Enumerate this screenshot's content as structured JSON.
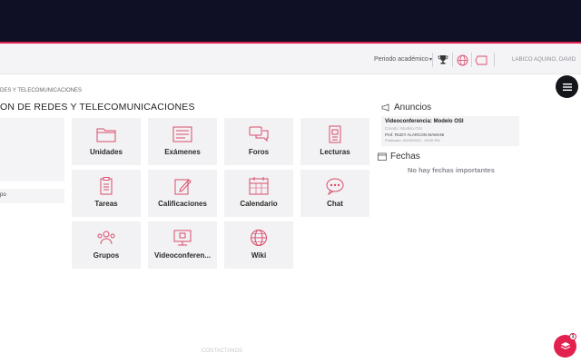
{
  "header": {
    "periodo_label": "Periodo académico",
    "username": "LABICO AQUINO, DAVID"
  },
  "breadcrumb": "DES Y TELECOMUNICACIONES",
  "course_title": "ON DE REDES Y TELECOMUNICACIONES",
  "left_panel": {
    "item_label": "po"
  },
  "tiles": [
    {
      "label": "Unidades",
      "icon": "folder-icon"
    },
    {
      "label": "Exámenes",
      "icon": "exam-icon"
    },
    {
      "label": "Foros",
      "icon": "forum-icon"
    },
    {
      "label": "Lecturas",
      "icon": "reading-icon"
    },
    {
      "label": "Tareas",
      "icon": "task-icon"
    },
    {
      "label": "Calificaciones",
      "icon": "grades-icon"
    },
    {
      "label": "Calendario",
      "icon": "calendar-icon"
    },
    {
      "label": "Chat",
      "icon": "chat-icon"
    },
    {
      "label": "Grupos",
      "icon": "groups-icon"
    },
    {
      "label": "Videoconferen...",
      "icon": "video-icon"
    },
    {
      "label": "Wiki",
      "icon": "globe-icon"
    }
  ],
  "anuncios": {
    "heading": "Anuncios",
    "item": {
      "title": "Videoconferencia: Modelo OSI",
      "subtitle": "Creado: Modelo OSI",
      "professor": "Prof. RUDY ALARCON MAMANI",
      "date": "Publicado: 04/05/2022 - 09:00 PM"
    }
  },
  "fechas": {
    "heading": "Fechas",
    "empty_text": "No hay fechas importantes"
  },
  "footer": {
    "text": "CONTACTANOS"
  },
  "fab": {
    "badge": "1"
  },
  "colors": {
    "topbar": "#0f1025",
    "accent": "#e2214e",
    "icon": "#d94c6a"
  }
}
